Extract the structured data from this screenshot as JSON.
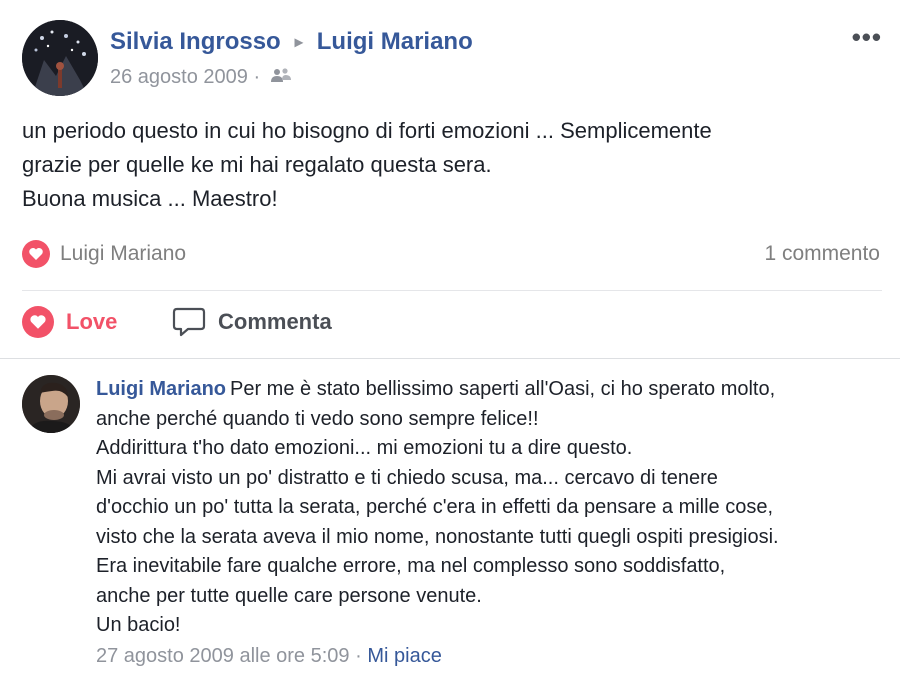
{
  "post": {
    "author": "Silvia Ingrosso",
    "separator": "▸",
    "target": "Luigi Mariano",
    "date": "26 agosto 2009",
    "dot": "·",
    "audience_icon": "friends-icon",
    "more_label": "•••",
    "text_lines": [
      "un periodo questo in cui ho bisogno di forti emozioni ... Semplicemente",
      "grazie per quelle ke mi hai regalato questa sera.",
      "Buona musica ... Maestro!"
    ]
  },
  "reactions": {
    "icon": "heart-icon",
    "names": "Luigi Mariano",
    "comment_count": "1 commento"
  },
  "actions": {
    "love_label": "Love",
    "comment_label": "Commenta"
  },
  "comment": {
    "author": "Luigi Mariano",
    "lines": [
      "Per me è stato bellissimo saperti all'Oasi, ci ho sperato molto,",
      "anche perché quando ti vedo sono sempre felice!!",
      "Addirittura t'ho dato emozioni... mi emozioni tu a dire questo.",
      "Mi avrai visto un po' distratto e ti chiedo scusa, ma... cercavo di tenere",
      "d'occhio un po' tutta la serata, perché c'era in effetti da pensare a mille cose,",
      "visto che la serata aveva il mio nome, nonostante tutti quegli ospiti presigiosi.",
      "Era inevitabile fare qualche errore, ma nel complesso sono soddisfatto,",
      "anche per tutte quelle care persone venute.",
      "Un bacio!"
    ],
    "timestamp": "27 agosto 2009 alle ore 5:09",
    "dot": "·",
    "like_label": "Mi piace"
  },
  "colors": {
    "link": "#365899",
    "love": "#f25268",
    "muted": "#90949c"
  }
}
